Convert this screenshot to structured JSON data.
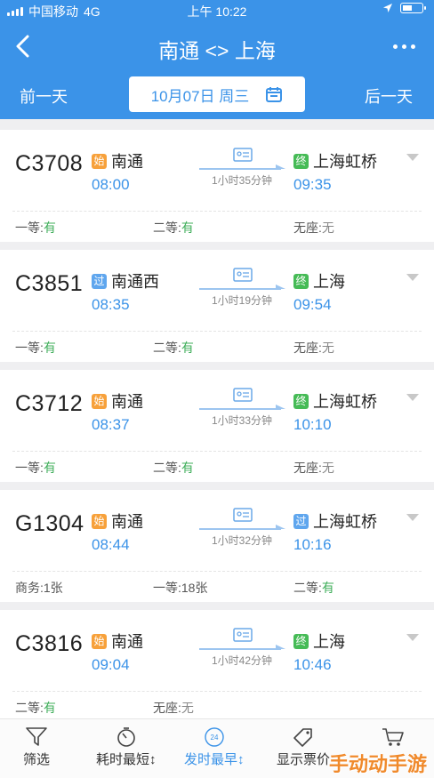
{
  "status": {
    "carrier": "中国移动",
    "network": "4G",
    "time": "上午 10:22"
  },
  "nav": {
    "title": "南通 <> 上海"
  },
  "date_bar": {
    "prev": "前一天",
    "date": "10月07日 周三",
    "next": "后一天"
  },
  "trains": [
    {
      "no": "C3708",
      "from_tag": "始",
      "from": "南通",
      "dep": "08:00",
      "duration": "1小时35分钟",
      "to_tag": "终",
      "to": "上海虹桥",
      "arr": "09:35",
      "seats": [
        {
          "label": "一等:",
          "value": "有"
        },
        {
          "label": "二等:",
          "value": "有"
        },
        {
          "label": "无座:",
          "value": "无"
        }
      ]
    },
    {
      "no": "C3851",
      "from_tag": "过",
      "from": "南通西",
      "dep": "08:35",
      "duration": "1小时19分钟",
      "to_tag": "终",
      "to": "上海",
      "arr": "09:54",
      "seats": [
        {
          "label": "一等:",
          "value": "有"
        },
        {
          "label": "二等:",
          "value": "有"
        },
        {
          "label": "无座:",
          "value": "无"
        }
      ]
    },
    {
      "no": "C3712",
      "from_tag": "始",
      "from": "南通",
      "dep": "08:37",
      "duration": "1小时33分钟",
      "to_tag": "终",
      "to": "上海虹桥",
      "arr": "10:10",
      "seats": [
        {
          "label": "一等:",
          "value": "有"
        },
        {
          "label": "二等:",
          "value": "有"
        },
        {
          "label": "无座:",
          "value": "无"
        }
      ]
    },
    {
      "no": "G1304",
      "from_tag": "始",
      "from": "南通",
      "dep": "08:44",
      "duration": "1小时32分钟",
      "to_tag": "过",
      "to": "上海虹桥",
      "arr": "10:16",
      "seats": [
        {
          "label": "商务:",
          "value": "1张"
        },
        {
          "label": "一等:",
          "value": "18张"
        },
        {
          "label": "二等:",
          "value": "有"
        }
      ]
    },
    {
      "no": "C3816",
      "from_tag": "始",
      "from": "南通",
      "dep": "09:04",
      "duration": "1小时42分钟",
      "to_tag": "终",
      "to": "上海",
      "arr": "10:46",
      "seats": [
        {
          "label": "二等:",
          "value": "有"
        },
        {
          "label": "无座:",
          "value": "无"
        }
      ]
    }
  ],
  "bottom_bar": {
    "filter": "筛选",
    "duration_sort": "耗时最短",
    "clock_badge": "24",
    "depart_sort": "发时最早",
    "show_price": "显示票价"
  },
  "watermark": "手动动手游",
  "colors": {
    "primary": "#3b93e8",
    "available": "#3fae5a",
    "start_tag": "#f7a13b",
    "pass_tag": "#5fa6ee",
    "end_tag": "#46bb56"
  }
}
